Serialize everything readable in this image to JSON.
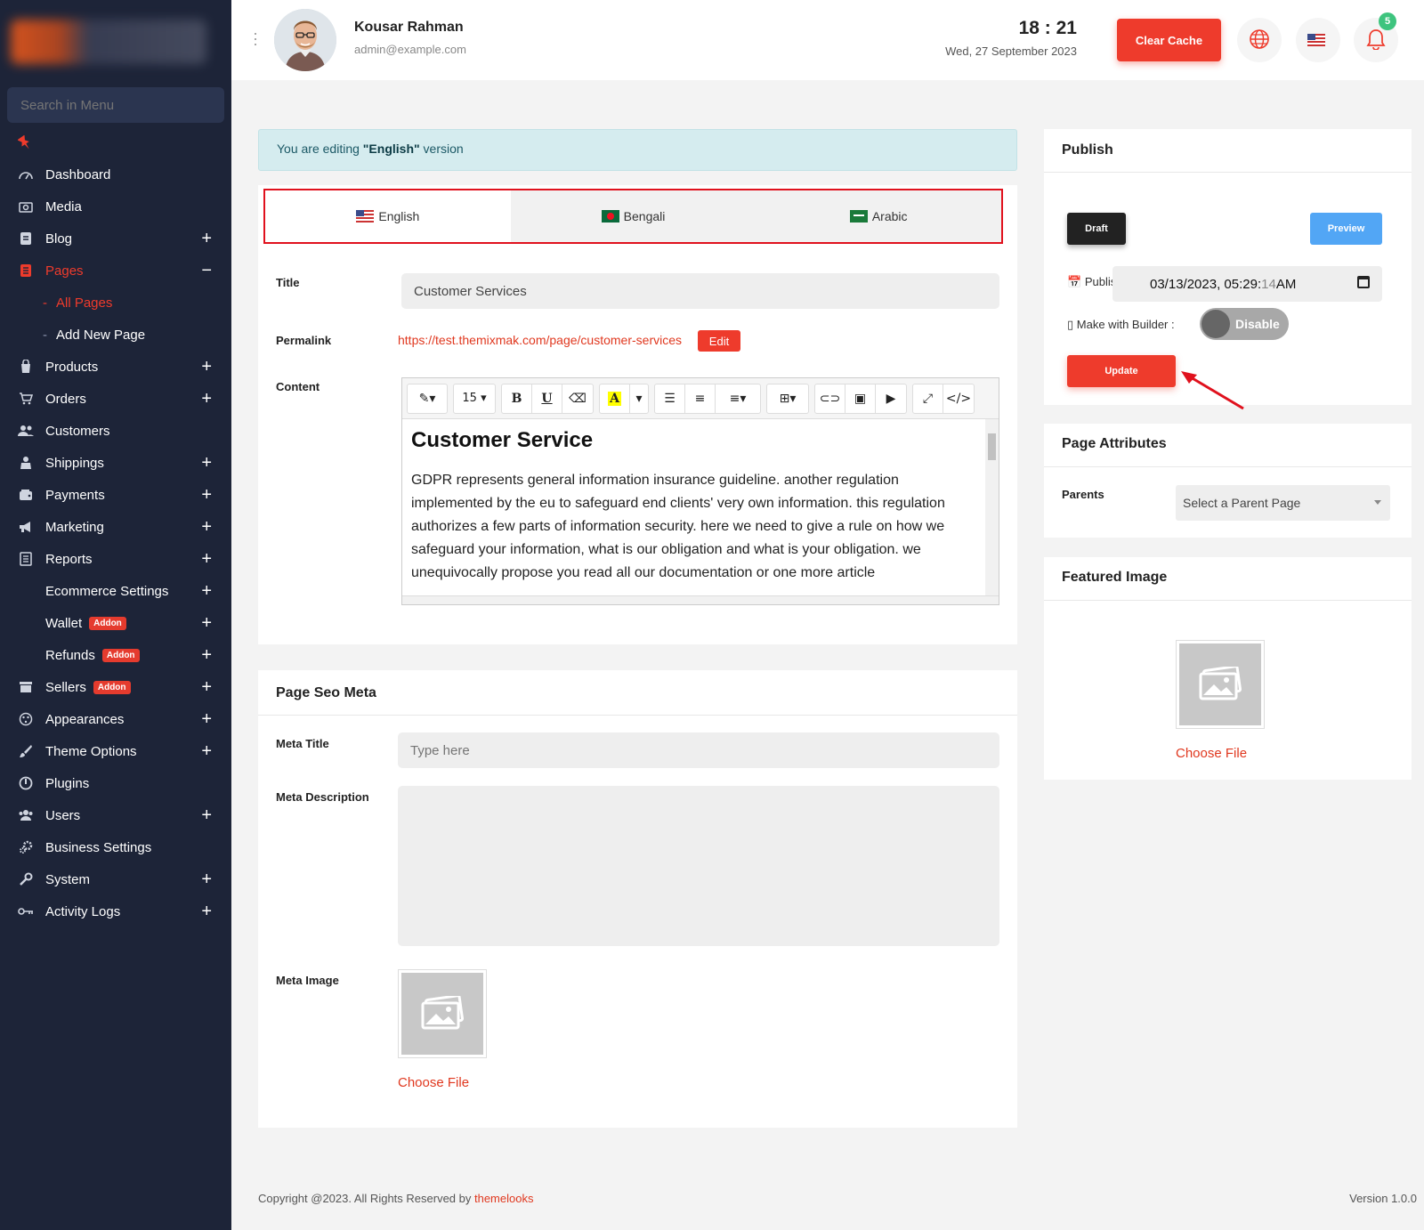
{
  "sidebar": {
    "search_placeholder": "Search in Menu",
    "items": [
      {
        "label": "Dashboard",
        "icon": "dashboard-icon",
        "expandable": false
      },
      {
        "label": "Media",
        "icon": "media-icon",
        "expandable": false
      },
      {
        "label": "Blog",
        "icon": "blog-icon",
        "expandable": true
      },
      {
        "label": "Pages",
        "icon": "pages-icon",
        "expandable": true,
        "active": true
      },
      {
        "label": "Products",
        "icon": "products-icon",
        "expandable": true
      },
      {
        "label": "Orders",
        "icon": "orders-icon",
        "expandable": true
      },
      {
        "label": "Customers",
        "icon": "customers-icon",
        "expandable": false
      },
      {
        "label": "Shippings",
        "icon": "shippings-icon",
        "expandable": true
      },
      {
        "label": "Payments",
        "icon": "payments-icon",
        "expandable": true
      },
      {
        "label": "Marketing",
        "icon": "marketing-icon",
        "expandable": true
      },
      {
        "label": "Reports",
        "icon": "reports-icon",
        "expandable": true
      },
      {
        "label": "Ecommerce Settings",
        "icon": "",
        "expandable": true
      },
      {
        "label": "Wallet",
        "icon": "",
        "expandable": true,
        "badge": "Addon"
      },
      {
        "label": "Refunds",
        "icon": "",
        "expandable": true,
        "badge": "Addon"
      },
      {
        "label": "Sellers",
        "icon": "sellers-icon",
        "expandable": true,
        "badge": "Addon"
      },
      {
        "label": "Appearances",
        "icon": "appearances-icon",
        "expandable": true
      },
      {
        "label": "Theme Options",
        "icon": "theme-options-icon",
        "expandable": true
      },
      {
        "label": "Plugins",
        "icon": "plugins-icon",
        "expandable": false
      },
      {
        "label": "Users",
        "icon": "users-icon",
        "expandable": true
      },
      {
        "label": "Business Settings",
        "icon": "business-settings-icon",
        "expandable": false
      },
      {
        "label": "System",
        "icon": "system-icon",
        "expandable": true
      },
      {
        "label": "Activity Logs",
        "icon": "activity-logs-icon",
        "expandable": true
      }
    ],
    "pages_sub": [
      "All Pages",
      "Add New Page"
    ]
  },
  "topbar": {
    "user_name": "Kousar Rahman",
    "user_email": "admin@example.com",
    "time": "18 : 21",
    "date": "Wed, 27 September 2023",
    "clear_cache": "Clear Cache",
    "notification_count": "5"
  },
  "editing": {
    "prefix": "You are editing ",
    "language": "\"English\"",
    "suffix": " version"
  },
  "language_tabs": [
    "English",
    "Bengali",
    "Arabic"
  ],
  "form": {
    "title_label": "Title",
    "title_value": "Customer Services",
    "permalink_label": "Permalink",
    "permalink_url": "https://test.themixmak.com/page/customer-services",
    "edit_label": "Edit",
    "content_label": "Content",
    "font_size": "15",
    "content_heading": "Customer Service",
    "content_body": "GDPR represents general information insurance guideline. another regulation implemented by the eu to safeguard end clients' very own information. this regulation authorizes a few parts of information security. here we need to give a rule on how we safeguard your information, what is our obligation and what is your obligation. we unequivocally propose you read all our documentation or one more article"
  },
  "seo": {
    "title": "Page Seo Meta",
    "meta_title_label": "Meta Title",
    "meta_title_placeholder": "Type here",
    "meta_description_label": "Meta Description",
    "meta_image_label": "Meta Image",
    "choose_file": "Choose File"
  },
  "publish": {
    "title": "Publish",
    "draft": "Draft",
    "preview": "Preview",
    "publish_label": "Publish :",
    "datetime_main": "03/13/2023, 05:29:",
    "datetime_seconds": "14",
    "datetime_ampm": " AM",
    "builder_label": "Make with Builder :",
    "builder_state": "Disable",
    "update": "Update"
  },
  "attributes": {
    "title": "Page Attributes",
    "parents_label": "Parents",
    "parent_select": "Select a Parent Page"
  },
  "featured": {
    "title": "Featured Image",
    "choose_file": "Choose File"
  },
  "footer": {
    "copyright": "Copyright @2023. All Rights Reserved by ",
    "brand": "themelooks",
    "version": "Version 1.0.0"
  },
  "colors": {
    "accent": "#ee3b2c",
    "sidebar_bg": "#1d2438",
    "preview_blue": "#52a6f5",
    "badge_green": "#3ec47e"
  }
}
